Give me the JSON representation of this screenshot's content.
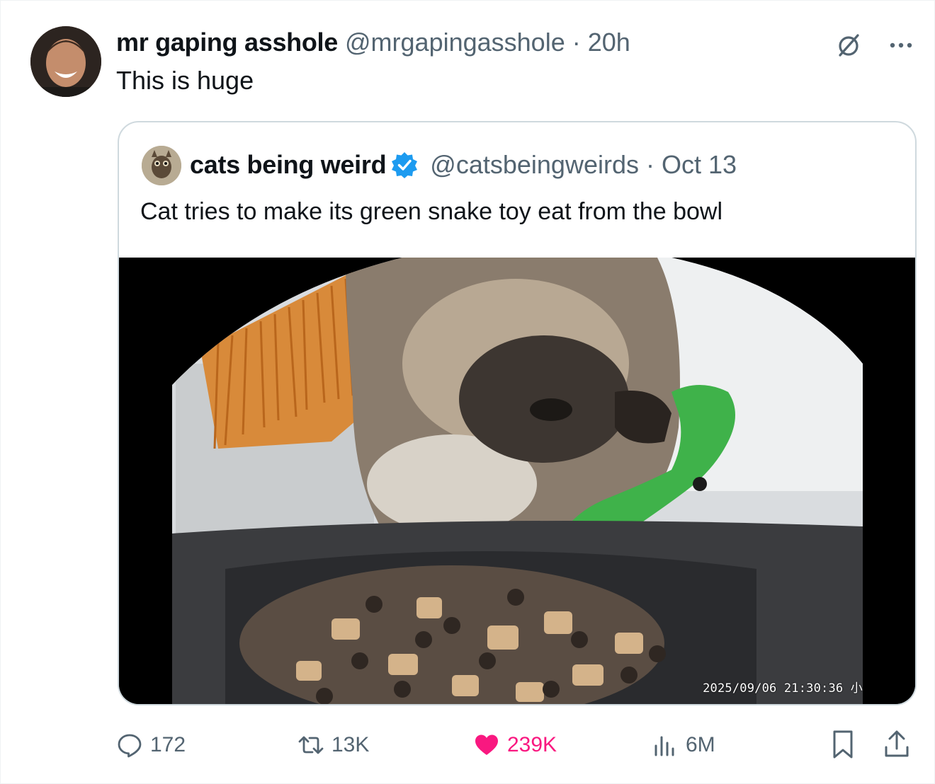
{
  "post": {
    "display_name": "mr gaping asshole",
    "handle": "@mrgapingasshole",
    "separator": "·",
    "time": "20h",
    "text": "This is huge"
  },
  "quoted_post": {
    "display_name": "cats being weird",
    "verified": true,
    "handle": "@catsbeingweirds",
    "separator": "·",
    "date": "Oct 13",
    "text": "Cat tries to make its green snake toy eat from the bowl",
    "media_timestamp": "2025/09/06  21:30:36 小"
  },
  "actions": {
    "replies": "172",
    "reposts": "13K",
    "likes": "239K",
    "views": "6M"
  },
  "icons": {
    "header": [
      "grok-icon",
      "more-icon"
    ],
    "actions": [
      "reply-icon",
      "repost-icon",
      "like-icon",
      "views-icon",
      "bookmark-icon",
      "share-icon"
    ]
  },
  "colors": {
    "text_primary": "#0f1419",
    "text_secondary": "#536471",
    "like": "#f91880",
    "verified": "#1d9bf0",
    "border": "#cfd9de"
  }
}
